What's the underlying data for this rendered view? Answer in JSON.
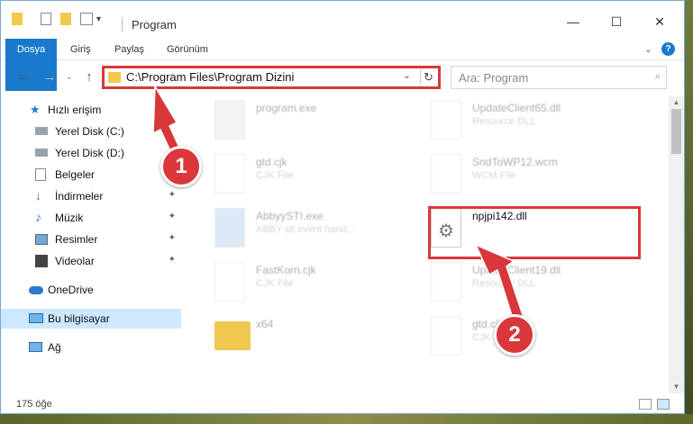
{
  "window": {
    "title": "Program",
    "controls": {
      "minimize": "—",
      "maximize": "☐",
      "close": "✕"
    }
  },
  "ribbon": {
    "tabs": [
      "Dosya",
      "Giriş",
      "Paylaş",
      "Görünüm"
    ],
    "expand_icon": "chevron-down-icon",
    "help": "?"
  },
  "navbar": {
    "back": "←",
    "forward": "→",
    "recent": "⌄",
    "up": "↑",
    "address": "C:\\Program Files\\Program Dizini",
    "address_chevron": "⌄",
    "refresh": "↻",
    "search_placeholder": "Ara: Program",
    "search_icon": "🔍"
  },
  "sidebar": {
    "items": [
      {
        "label": "Hızlı erişim",
        "icon": "star-icon",
        "pinned": false
      },
      {
        "label": "Yerel Disk (C:)",
        "icon": "drive-icon",
        "pinned": false
      },
      {
        "label": "Yerel Disk (D:)",
        "icon": "drive-icon",
        "pinned": false
      },
      {
        "label": "Belgeler",
        "icon": "documents-icon",
        "pinned": false
      },
      {
        "label": "İndirmeler",
        "icon": "download-icon",
        "pinned": true
      },
      {
        "label": "Müzik",
        "icon": "music-icon",
        "pinned": true
      },
      {
        "label": "Resimler",
        "icon": "pictures-icon",
        "pinned": true
      },
      {
        "label": "Videolar",
        "icon": "video-icon",
        "pinned": true
      },
      {
        "label": "OneDrive",
        "icon": "cloud-icon",
        "pinned": false
      },
      {
        "label": "Bu bilgisayar",
        "icon": "computer-icon",
        "pinned": false,
        "selected": true
      },
      {
        "label": "Ağ",
        "icon": "network-icon",
        "pinned": false
      }
    ],
    "pin_glyph": "📌"
  },
  "files": [
    {
      "name": "program.exe",
      "sub": "",
      "faded": true,
      "icon": "exe-icon"
    },
    {
      "name": "UpdateClient65.dll",
      "sub": "Resource DLL",
      "faded": true,
      "icon": "dll-icon"
    },
    {
      "name": "gtd.cjk",
      "sub": "CJK File",
      "faded": true,
      "icon": "file-icon"
    },
    {
      "name": "SndToWP12.wcm",
      "sub": "WCM File",
      "faded": true,
      "icon": "file-icon"
    },
    {
      "name": "AbbyySTI.exe",
      "sub": "ABBY sti event hand...",
      "faded": true,
      "icon": "exe-icon"
    },
    {
      "name": "npjpi142.dll",
      "sub": "",
      "faded": false,
      "icon": "dll-icon"
    },
    {
      "name": "FastKorn.cjk",
      "sub": "CJK File",
      "faded": true,
      "icon": "file-icon"
    },
    {
      "name": "UpdateClient19.dll",
      "sub": "Resource DLL",
      "faded": true,
      "icon": "dll-icon"
    },
    {
      "name": "x64",
      "sub": "",
      "faded": true,
      "icon": "folder-icon"
    },
    {
      "name": "gtd.cjk",
      "sub": "CJK File",
      "faded": true,
      "icon": "file-icon"
    }
  ],
  "status": {
    "count": "175 öğe"
  },
  "callouts": [
    "1",
    "2"
  ],
  "colors": {
    "accent": "#1979ca",
    "highlight": "#d9373a",
    "selected": "#cde8ff"
  }
}
